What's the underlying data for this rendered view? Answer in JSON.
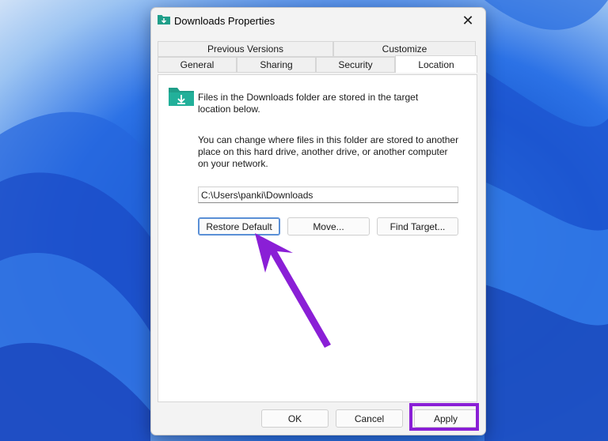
{
  "window": {
    "title": "Downloads Properties",
    "close_symbol": "✕"
  },
  "tabs": {
    "row_back": [
      {
        "label": "Previous Versions"
      },
      {
        "label": "Customize"
      }
    ],
    "row_front": [
      {
        "label": "General"
      },
      {
        "label": "Sharing"
      },
      {
        "label": "Security"
      },
      {
        "label": "Location",
        "active": true
      }
    ]
  },
  "location": {
    "intro": "Files in the Downloads folder are stored in the target location below.",
    "description": "You can change where files in this folder are stored to another place on this hard drive, another drive, or another computer on your network.",
    "path": "C:\\Users\\panki\\Downloads",
    "restore_default_label": "Restore Default",
    "move_label": "Move...",
    "find_target_label": "Find Target..."
  },
  "footer": {
    "ok_label": "OK",
    "cancel_label": "Cancel",
    "apply_label": "Apply"
  },
  "annotation": {
    "color": "#8a1fd6"
  },
  "icons": {
    "folder": "folder-download-icon",
    "close": "close-icon"
  },
  "colors": {
    "folder_teal": "#1f9e89",
    "focus_blue": "#5a8fd6"
  }
}
